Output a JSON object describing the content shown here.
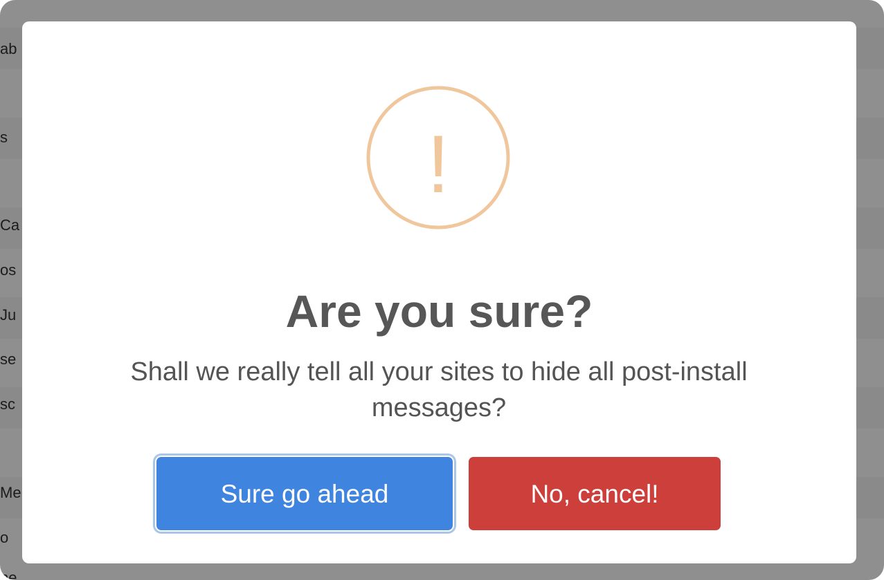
{
  "background": {
    "fragments": [
      "ab",
      "s",
      "Ca",
      "os",
      "Ju",
      "se",
      "sc",
      "Me",
      "o",
      "ne"
    ]
  },
  "dialog": {
    "icon": "warning-exclamation-icon",
    "icon_glyph": "!",
    "icon_color": "#f0c79d",
    "title": "Are you sure?",
    "message": "Shall we really tell all your sites to hide all post-install messages?",
    "confirm_label": "Sure go ahead",
    "cancel_label": "No, cancel!",
    "confirm_color": "#3f85e0",
    "cancel_color": "#cd3f3a"
  }
}
